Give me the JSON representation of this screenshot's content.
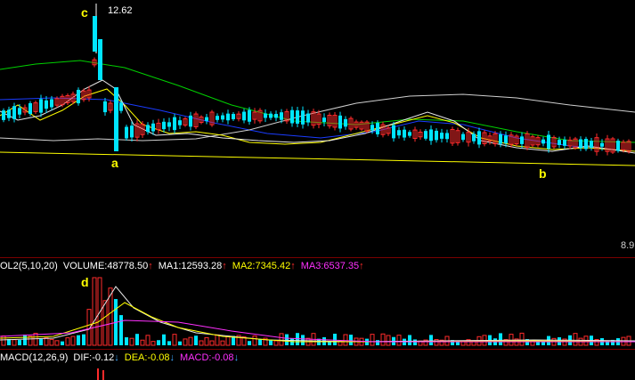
{
  "colors": {
    "background": "#000000",
    "up": "#ff2b2b",
    "down": "#00e5ff",
    "ma_white": "#e8e8e8",
    "ma_yellow": "#ffff00",
    "ma_magenta": "#ff30ff",
    "ma_green": "#00d000",
    "ma_blue": "#1a3cff",
    "ma_gray": "#cfcfcf",
    "separator": "#7a0000"
  },
  "price_panel": {
    "high_label": "12.62",
    "right_axis_label": "8.9",
    "markers": {
      "a": "a",
      "b": "b",
      "c": "c"
    }
  },
  "volume_panel": {
    "header": "OL2(5,10,20)",
    "items": [
      {
        "name": "VOLUME",
        "value": "VOLUME:48778.50",
        "color": "#ffffff",
        "arrow": "↑"
      },
      {
        "name": "MA1",
        "value": "MA1:12593.28",
        "color": "#ffffff",
        "arrow": "↑"
      },
      {
        "name": "MA2",
        "value": "MA2:7345.42",
        "color": "#ffff00",
        "arrow": "↑"
      },
      {
        "name": "MA3",
        "value": "MA3:6537.35",
        "color": "#ff30ff",
        "arrow": "↑"
      }
    ],
    "marker_d": "d"
  },
  "macd_panel": {
    "header": "MACD(12,26,9)",
    "items": [
      {
        "name": "DIF",
        "value": "DIF:-0.12",
        "color": "#ffffff",
        "arrow": "↓"
      },
      {
        "name": "DEA",
        "value": "DEA:-0.08",
        "color": "#ffff00",
        "arrow": "↓"
      },
      {
        "name": "MACD",
        "value": "MACD:-0.08",
        "color": "#ff30ff",
        "arrow": "↓"
      }
    ]
  }
}
